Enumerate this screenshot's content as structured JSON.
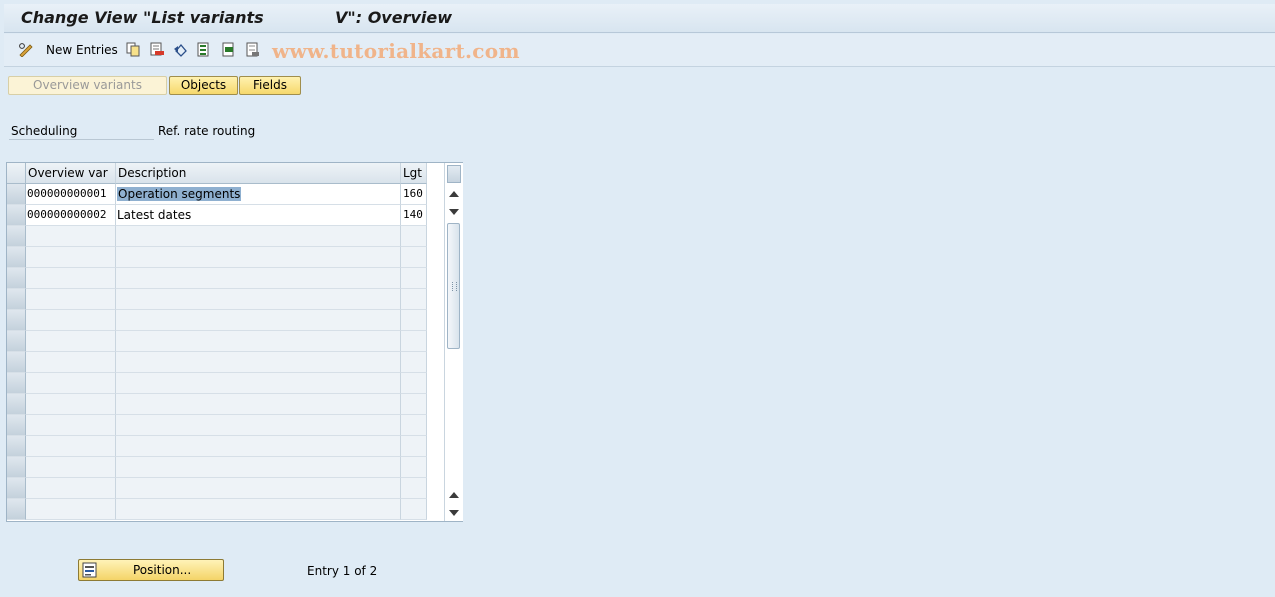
{
  "title": {
    "part1": "Change View \"List variants",
    "part2": "V\": Overview"
  },
  "toolbar": {
    "new_entries": "New Entries",
    "watermark": "www.tutorialkart.com",
    "icons": [
      "pencil-glasses-icon",
      "copy-icon",
      "delete-icon",
      "undo-icon",
      "select-all-icon",
      "select-block-icon",
      "deselect-all-icon"
    ]
  },
  "tabs": {
    "overview_variants": "Overview variants",
    "objects": "Objects",
    "fields": "Fields"
  },
  "context": {
    "label": "Scheduling",
    "value": "Ref. rate routing"
  },
  "table": {
    "headers": [
      "Overview var",
      "Description",
      "Lgt"
    ],
    "rows": [
      {
        "var": "000000000001",
        "desc": "Operation segments",
        "lgt": "160"
      },
      {
        "var": "000000000002",
        "desc": "Latest dates",
        "lgt": "140"
      }
    ]
  },
  "footer": {
    "position_label": "Position...",
    "entry_text": "Entry 1 of 2"
  },
  "colors": {
    "background": "#dfebf5",
    "button": "#f6d86c",
    "watermark": "#f0b48a",
    "highlight": "#8fb0d0"
  }
}
